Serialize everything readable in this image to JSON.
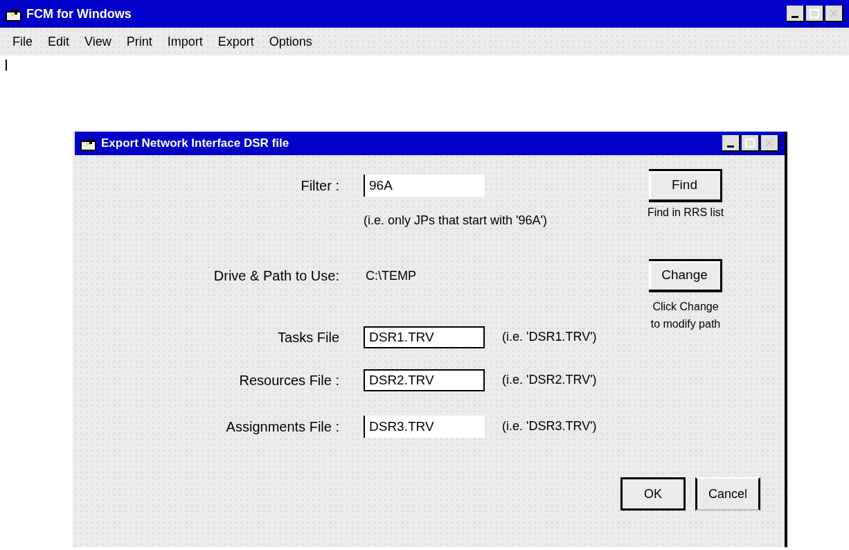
{
  "window": {
    "title": "FCM for Windows"
  },
  "menu": [
    "File",
    "Edit",
    "View",
    "Print",
    "Import",
    "Export",
    "Options"
  ],
  "dialog": {
    "title": "Export Network Interface DSR file",
    "filter": {
      "label": "Filter :",
      "value": "96A",
      "hint": "(i.e. only JPs that start with '96A')"
    },
    "find": {
      "label": "Find",
      "note": "Find in RRS list"
    },
    "path": {
      "label": "Drive & Path to Use:",
      "value": "C:\\TEMP"
    },
    "change": {
      "label": "Change",
      "note": [
        "Click Change",
        "to modify path"
      ]
    },
    "files": [
      {
        "label": "Tasks File",
        "value": "DSR1.TRV",
        "hint": "(i.e. 'DSR1.TRV')",
        "kind": "boxed"
      },
      {
        "label": "Resources File :",
        "value": "DSR2.TRV",
        "hint": "(i.e. 'DSR2.TRV')",
        "kind": "boxed"
      },
      {
        "label": "Assignments File :",
        "value": "DSR3.TRV",
        "hint": "(i.e. 'DSR3.TRV')",
        "kind": "plain"
      }
    ],
    "buttons": [
      {
        "label": "OK",
        "default": true
      },
      {
        "label": "Cancel",
        "default": false
      }
    ]
  }
}
